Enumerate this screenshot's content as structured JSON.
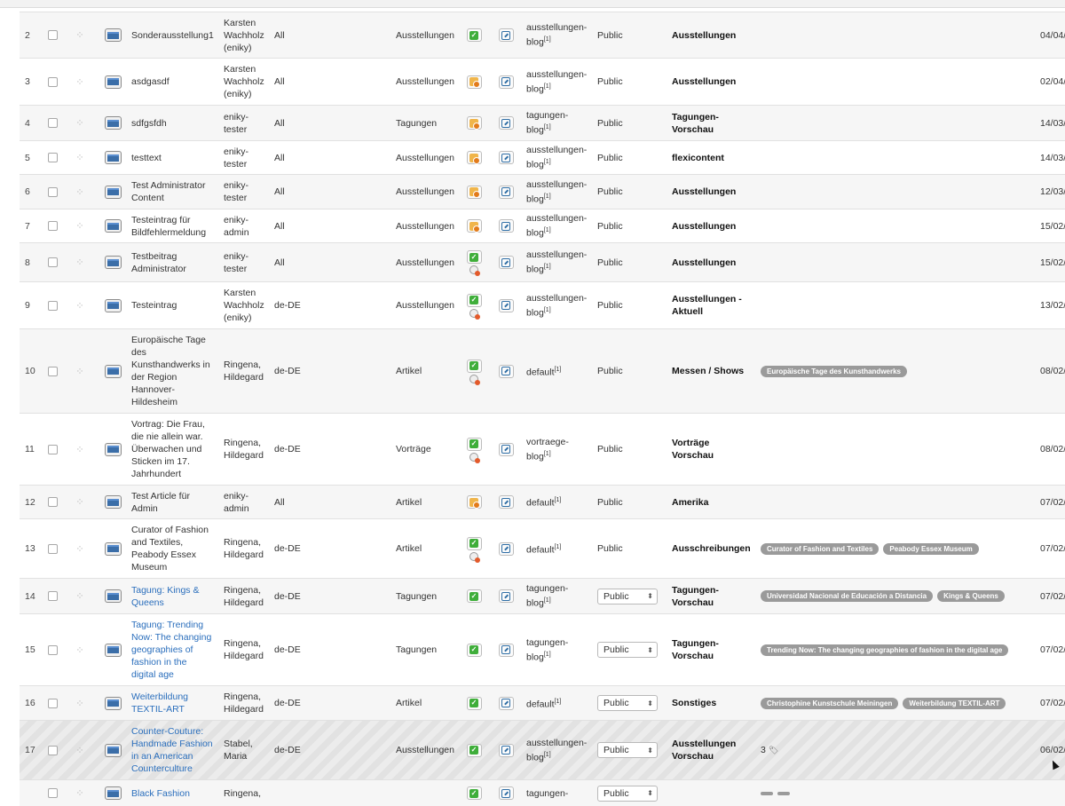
{
  "rows": [
    {
      "num": "2",
      "title": [
        "Sonderausstellung1"
      ],
      "author": [
        "Karsten",
        "Wachholz",
        "(eniky)"
      ],
      "lang": "All",
      "type": "Ausstellungen",
      "state": "published",
      "tpl": [
        "ausstellungen-",
        "blog"
      ],
      "tpl_sup": "[1]",
      "access": "Public",
      "access_select": false,
      "category": [
        "Ausstellungen"
      ],
      "tags": [],
      "date": "04/04/",
      "h": 52
    },
    {
      "num": "3",
      "title": [
        "asdgasdf"
      ],
      "author": [
        "Karsten",
        "Wachholz",
        "(eniky)"
      ],
      "lang": "All",
      "type": "Ausstellungen",
      "state": "pending",
      "tpl": [
        "ausstellungen-",
        "blog"
      ],
      "tpl_sup": "[1]",
      "access": "Public",
      "access_select": false,
      "category": [
        "Ausstellungen"
      ],
      "tags": [],
      "date": "02/04/",
      "h": 53
    },
    {
      "num": "4",
      "title": [
        "sdfgsfdh"
      ],
      "author": [
        "eniky-",
        "tester"
      ],
      "lang": "All",
      "type": "Tagungen",
      "state": "pending",
      "tpl": [
        "tagungen-",
        "blog"
      ],
      "tpl_sup": "[1]",
      "access": "Public",
      "access_select": false,
      "category": [
        "Tagungen-",
        "Vorschau"
      ],
      "tags": [],
      "date": "14/03/",
      "h": 40
    },
    {
      "num": "5",
      "title": [
        "testtext"
      ],
      "author": [
        "eniky-",
        "tester"
      ],
      "lang": "All",
      "type": "Ausstellungen",
      "state": "pending",
      "tpl": [
        "ausstellungen-",
        "blog"
      ],
      "tpl_sup": "[1]",
      "access": "Public",
      "access_select": false,
      "category": [
        "flexicontent"
      ],
      "tags": [],
      "date": "14/03/",
      "h": 38
    },
    {
      "num": "6",
      "title": [
        "Test Administrator",
        "Content"
      ],
      "author": [
        "eniky-",
        "tester"
      ],
      "lang": "All",
      "type": "Ausstellungen",
      "state": "pending",
      "tpl": [
        "ausstellungen-",
        "blog"
      ],
      "tpl_sup": "[1]",
      "access": "Public",
      "access_select": false,
      "category": [
        "Ausstellungen"
      ],
      "tags": [],
      "date": "12/03/",
      "h": 39
    },
    {
      "num": "7",
      "title": [
        "Testeintrag für",
        "Bildfehlermeldung"
      ],
      "author": [
        "eniky-",
        "admin"
      ],
      "lang": "All",
      "type": "Ausstellungen",
      "state": "pending",
      "tpl": [
        "ausstellungen-",
        "blog"
      ],
      "tpl_sup": "[1]",
      "access": "Public",
      "access_select": false,
      "category": [
        "Ausstellungen"
      ],
      "tags": [],
      "date": "15/02/",
      "h": 38
    },
    {
      "num": "8",
      "title": [
        "Testbeitrag",
        "Administrator"
      ],
      "author": [
        "eniky-",
        "tester"
      ],
      "lang": "All",
      "type": "Ausstellungen",
      "state": "published-expired",
      "tpl": [
        "ausstellungen-",
        "blog"
      ],
      "tpl_sup": "[1]",
      "access": "Public",
      "access_select": false,
      "category": [
        "Ausstellungen"
      ],
      "tags": [],
      "date": "15/02/",
      "h": 44
    },
    {
      "num": "9",
      "title": [
        "Testeintrag"
      ],
      "author": [
        "Karsten",
        "Wachholz",
        "(eniky)"
      ],
      "lang": "de-DE",
      "type": "Ausstellungen",
      "state": "published-expired",
      "tpl": [
        "ausstellungen-",
        "blog"
      ],
      "tpl_sup": "[1]",
      "access": "Public",
      "access_select": false,
      "category": [
        "Ausstellungen -",
        "Aktuell"
      ],
      "tags": [],
      "date": "13/02/",
      "h": 53
    },
    {
      "num": "10",
      "title": [
        "Europäische Tage",
        "des",
        "Kunsthandwerks in",
        "der Region",
        "Hannover-",
        "Hildesheim"
      ],
      "author": [
        "Ringena,",
        "Hildegard"
      ],
      "lang": "de-DE",
      "type": "Artikel",
      "state": "published-expired",
      "tpl": [
        "default"
      ],
      "tpl_sup": "[1]",
      "access": "Public",
      "access_select": false,
      "category": [
        "Messen / Shows"
      ],
      "tags": [
        "Europäische Tage des Kunsthandwerks"
      ],
      "date": "08/02/",
      "h": 95
    },
    {
      "num": "11",
      "title": [
        "Vortrag: Die Frau,",
        "die nie allein war.",
        "Überwachen und",
        "Sticken im 17.",
        "Jahrhundert"
      ],
      "author": [
        "Ringena,",
        "Hildegard"
      ],
      "lang": "de-DE",
      "type": "Vorträge",
      "state": "published-expired",
      "tpl": [
        "vortraege-",
        "blog"
      ],
      "tpl_sup": "[1]",
      "access": "Public",
      "access_select": false,
      "category": [
        "Vorträge",
        "Vorschau"
      ],
      "tags": [],
      "date": "08/02/",
      "h": 81
    },
    {
      "num": "12",
      "title": [
        "Test Article für",
        "Admin"
      ],
      "author": [
        "eniky-",
        "admin"
      ],
      "lang": "All",
      "type": "Artikel",
      "state": "pending",
      "tpl": [
        "default"
      ],
      "tpl_sup": "[1]",
      "access": "Public",
      "access_select": false,
      "category": [
        "Amerika"
      ],
      "tags": [],
      "date": "07/02/",
      "h": 38
    },
    {
      "num": "13",
      "title": [
        "Curator of Fashion",
        "and Textiles,",
        "Peabody Essex",
        "Museum"
      ],
      "author": [
        "Ringena,",
        "Hildegard"
      ],
      "lang": "de-DE",
      "type": "Artikel",
      "state": "published-expired",
      "tpl": [
        "default"
      ],
      "tpl_sup": "[1]",
      "access": "Public",
      "access_select": false,
      "category": [
        "Ausschreibungen"
      ],
      "tags": [
        "Curator of Fashion and Textiles",
        "Peabody Essex Museum"
      ],
      "date": "07/02/",
      "h": 67
    },
    {
      "num": "14",
      "title": [
        "Tagung: Kings &",
        "Queens"
      ],
      "link": true,
      "author": [
        "Ringena,",
        "Hildegard"
      ],
      "lang": "de-DE",
      "type": "Tagungen",
      "state": "published",
      "tpl": [
        "tagungen-",
        "blog"
      ],
      "tpl_sup": "[1]",
      "access": "Public",
      "access_select": true,
      "category": [
        "Tagungen-",
        "Vorschau"
      ],
      "tags": [
        "Universidad Nacional de Educación a Distancia",
        "Kings & Queens"
      ],
      "date": "07/02/",
      "h": 40
    },
    {
      "num": "15",
      "title": [
        "Tagung: Trending",
        "Now: The changing",
        "geographies of",
        "fashion in the",
        "digital age"
      ],
      "link": true,
      "author": [
        "Ringena,",
        "Hildegard"
      ],
      "lang": "de-DE",
      "type": "Tagungen",
      "state": "published",
      "tpl": [
        "tagungen-",
        "blog"
      ],
      "tpl_sup": "[1]",
      "access": "Public",
      "access_select": true,
      "category": [
        "Tagungen-",
        "Vorschau"
      ],
      "tags": [
        "Trending Now: The changing geographies of fashion in the digital age"
      ],
      "date": "07/02/",
      "h": 81
    },
    {
      "num": "16",
      "title": [
        "Weiterbildung",
        "TEXTIL-ART"
      ],
      "link": true,
      "author": [
        "Ringena,",
        "Hildegard"
      ],
      "lang": "de-DE",
      "type": "Artikel",
      "state": "published",
      "tpl": [
        "default"
      ],
      "tpl_sup": "[1]",
      "access": "Public",
      "access_select": true,
      "category": [
        "Sonstiges"
      ],
      "tags": [
        "Christophine Kunstschule Meiningen",
        "Weiterbildung TEXTIL-ART"
      ],
      "date": "07/02/",
      "h": 39
    },
    {
      "num": "17",
      "title": [
        "Counter-Couture:",
        "Handmade Fashion",
        "in an American",
        "Counterculture"
      ],
      "link": true,
      "hatched": true,
      "author": [
        "Stabel,",
        "Maria"
      ],
      "lang": "de-DE",
      "type": "Ausstellungen",
      "state": "published",
      "tpl": [
        "ausstellungen-",
        "blog"
      ],
      "tpl_sup": "[1]",
      "access": "Public",
      "access_select": true,
      "category": [
        "Ausstellungen",
        "Vorschau"
      ],
      "tags": [],
      "count": "3",
      "date": "06/02/",
      "h": 67
    },
    {
      "num": "",
      "title": [
        "Black Fashion",
        ""
      ],
      "link": true,
      "author": [
        "Ringena,",
        ""
      ],
      "lang": "",
      "type": "",
      "state": "published",
      "tpl": [
        "tagungen-",
        ""
      ],
      "tpl_sup": "",
      "access": "Public",
      "access_select": true,
      "category": [
        ""
      ],
      "tags": [
        "",
        ""
      ],
      "date": "",
      "h": 30
    }
  ]
}
